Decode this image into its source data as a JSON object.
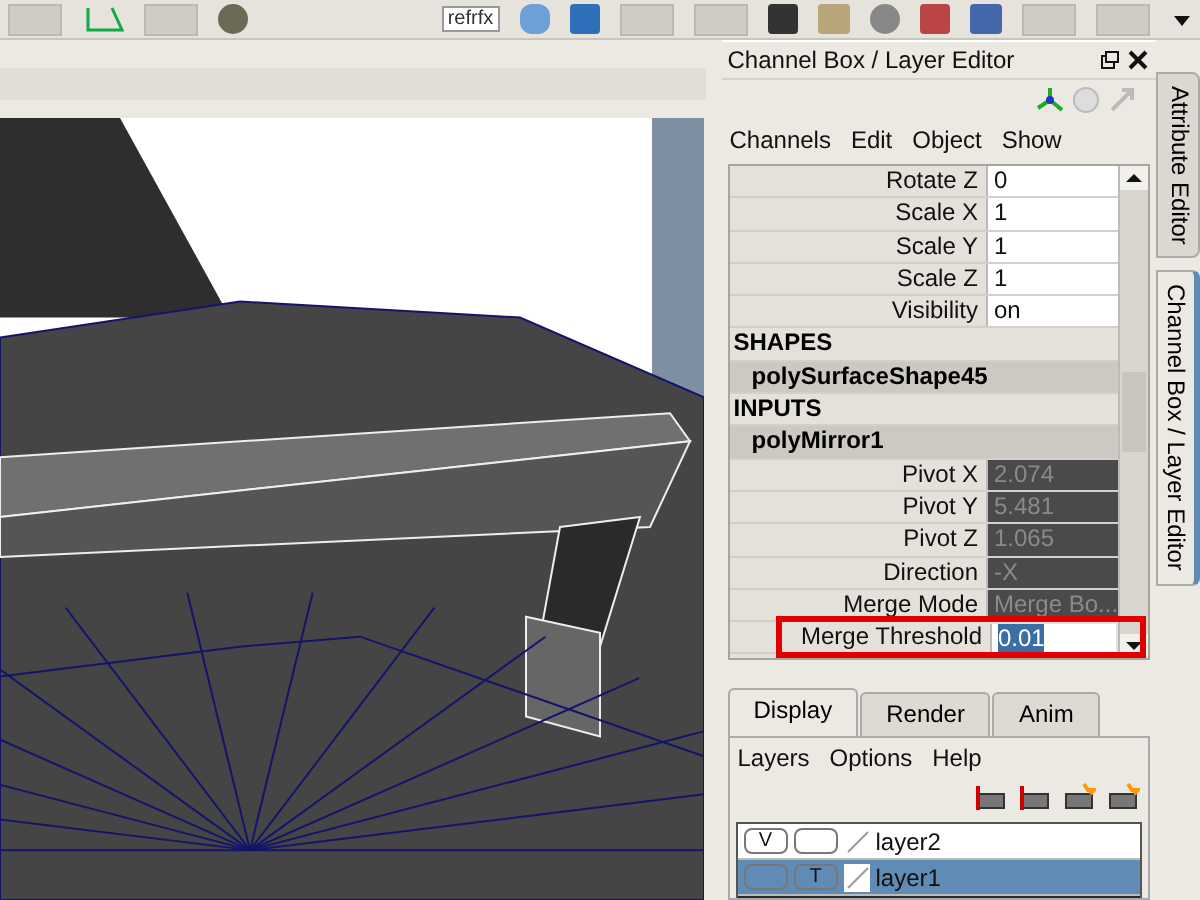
{
  "toolbar": {
    "label": "refrfx"
  },
  "panel": {
    "title": "Channel Box / Layer Editor"
  },
  "channel_menu": [
    "Channels",
    "Edit",
    "Object",
    "Show"
  ],
  "channels": [
    {
      "kind": "attr",
      "name": "Rotate Z",
      "value": "0",
      "connected": false
    },
    {
      "kind": "attr",
      "name": "Scale X",
      "value": "1",
      "connected": false
    },
    {
      "kind": "attr",
      "name": "Scale Y",
      "value": "1",
      "connected": false
    },
    {
      "kind": "attr",
      "name": "Scale Z",
      "value": "1",
      "connected": false
    },
    {
      "kind": "attr",
      "name": "Visibility",
      "value": "on",
      "connected": false
    },
    {
      "kind": "section",
      "name": "SHAPES"
    },
    {
      "kind": "node",
      "name": "polySurfaceShape45"
    },
    {
      "kind": "section",
      "name": "INPUTS"
    },
    {
      "kind": "node",
      "name": "polyMirror1"
    },
    {
      "kind": "attr",
      "name": "Pivot X",
      "value": "2.074",
      "connected": true
    },
    {
      "kind": "attr",
      "name": "Pivot Y",
      "value": "5.481",
      "connected": true
    },
    {
      "kind": "attr",
      "name": "Pivot Z",
      "value": "1.065",
      "connected": true
    },
    {
      "kind": "attr",
      "name": "Direction",
      "value": "-X",
      "connected": true
    },
    {
      "kind": "attr",
      "name": "Merge Mode",
      "value": "Merge Bo...",
      "connected": true
    },
    {
      "kind": "attr",
      "name": "Merge Threshold",
      "value": "0.01",
      "connected": false,
      "editing": true,
      "highlighted": true
    }
  ],
  "layer_tabs": [
    {
      "label": "Display",
      "selected": true
    },
    {
      "label": "Render",
      "selected": false
    },
    {
      "label": "Anim",
      "selected": false
    }
  ],
  "layer_menu": [
    "Layers",
    "Options",
    "Help"
  ],
  "layers": [
    {
      "name": "layer2",
      "visibility": "V",
      "selected": false
    },
    {
      "name": "layer1",
      "display": "T",
      "selected": true
    }
  ],
  "side_tabs": [
    {
      "label": "Attribute Editor",
      "selected": false
    },
    {
      "label": "Channel Box / Layer Editor",
      "selected": true
    }
  ]
}
